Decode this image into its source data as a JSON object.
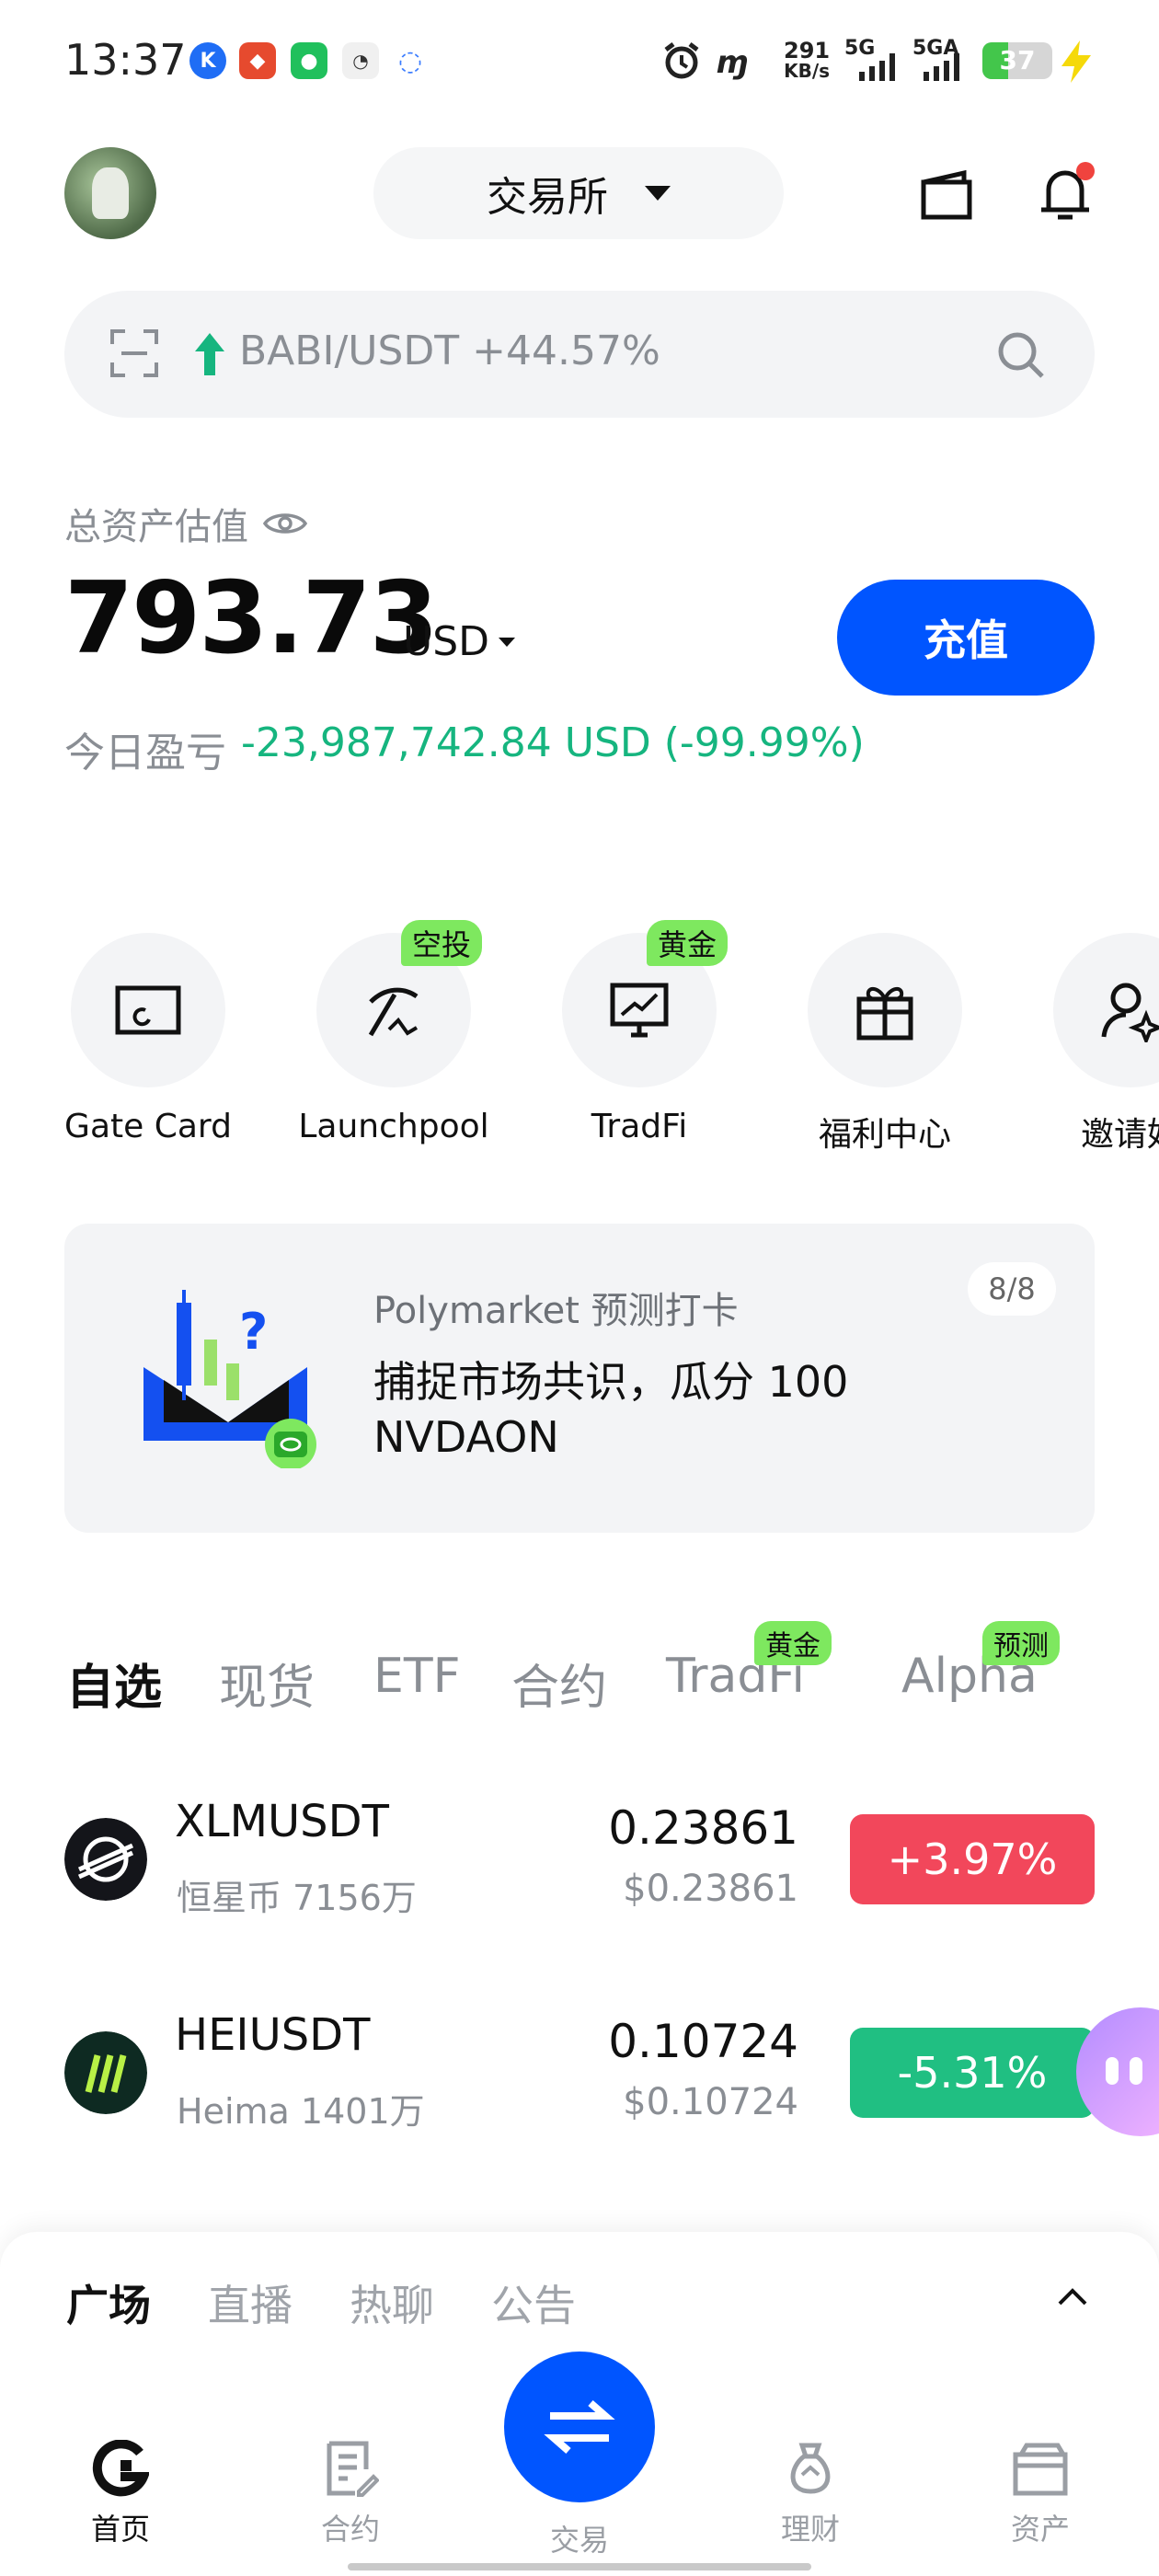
{
  "status_bar": {
    "time": "13:37",
    "net_speed_value": "291",
    "net_speed_unit": "KB/s",
    "sig1": "5G",
    "sig2": "5GA",
    "battery": "37"
  },
  "header": {
    "exchange_label": "交易所"
  },
  "search": {
    "text": "BABI/USDT +44.57%"
  },
  "assets": {
    "label": "总资产估值",
    "value": "793.73",
    "currency": "USD",
    "deposit_label": "充值",
    "pnl_label": "今日盈亏",
    "pnl_value": "-23,987,742.84 USD (-99.99%)"
  },
  "quick_actions": [
    {
      "label": "Gate Card",
      "tag": ""
    },
    {
      "label": "Launchpool",
      "tag": "空投"
    },
    {
      "label": "TradFi",
      "tag": "黄金"
    },
    {
      "label": "福利中心",
      "tag": ""
    },
    {
      "label": "邀请好",
      "tag": ""
    }
  ],
  "banner": {
    "subtitle": "Polymarket 预测打卡",
    "title": "捕捉市场共识，瓜分 100 NVDAON",
    "counter": "8/8"
  },
  "market_tabs": [
    {
      "label": "自选",
      "tag": ""
    },
    {
      "label": "现货",
      "tag": ""
    },
    {
      "label": "ETF",
      "tag": ""
    },
    {
      "label": "合约",
      "tag": ""
    },
    {
      "label": "TradFi",
      "tag": "黄金"
    },
    {
      "label": "Alpha",
      "tag": "预测"
    }
  ],
  "market_rows": [
    {
      "pair": "XLMUSDT",
      "name": "恒星币",
      "volume": "7156万",
      "price": "0.23861",
      "price_usd": "$0.23861",
      "change": "+3.97%",
      "change_color": "#f2475b"
    },
    {
      "pair": "HEIUSDT",
      "name": "Heima",
      "volume": "1401万",
      "price": "0.10724",
      "price_usd": "$0.10724",
      "change": "-5.31%",
      "change_color": "#20bf82"
    }
  ],
  "feed_tabs": [
    "广场",
    "直播",
    "热聊",
    "公告"
  ],
  "bottom_nav": [
    {
      "label": "首页"
    },
    {
      "label": "合约"
    },
    {
      "label": "交易"
    },
    {
      "label": "理财"
    },
    {
      "label": "资产"
    }
  ],
  "colors": {
    "brand_blue": "#0055ff",
    "gain_green": "#16b57f",
    "up_red": "#f2475b",
    "tag_green": "#7ee85f"
  }
}
